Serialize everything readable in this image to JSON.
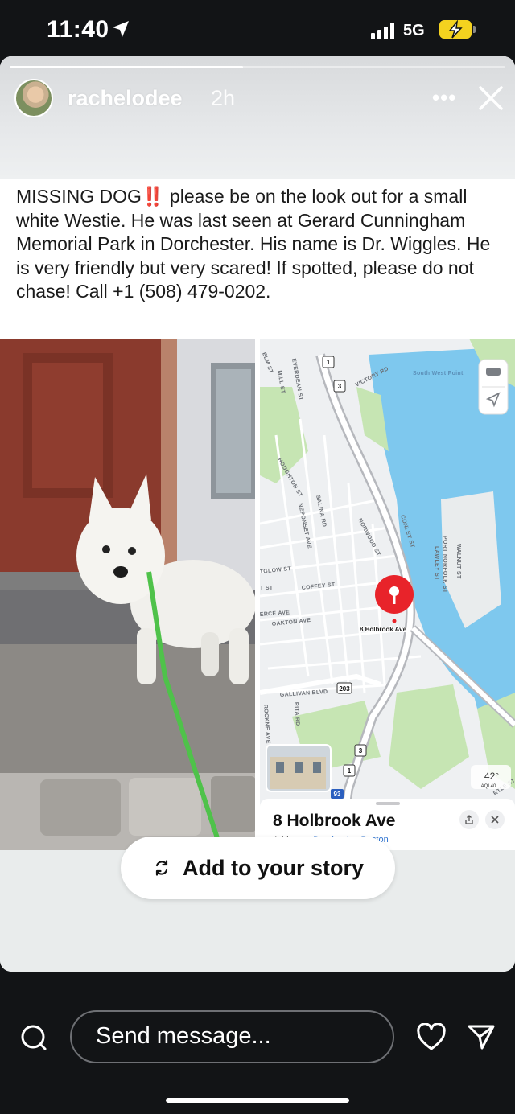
{
  "status_bar": {
    "time": "11:40",
    "network": "5G"
  },
  "story": {
    "username": "rachelodee",
    "posted_ago": "2h",
    "progress": 0.47,
    "post_text": "MISSING DOG‼️ please be on the look out for a small white Westie. He was last seen at Gerard Cunningham Memorial Park in Dorchester. His name is Dr. Wiggles. He is very friendly but very scared! If spotted, please do not chase! Call +1 (508) 479-0202."
  },
  "map": {
    "pin_label": "8 Holbrook Ave",
    "place_title": "8 Holbrook Ave",
    "place_type": "Address",
    "place_separator": " · ",
    "place_location": "Dorchester, Boston",
    "temperature": "42°",
    "aqi": "AQI 40",
    "area_label": "South West Point",
    "streets": {
      "victory_rd": "VICTORY RD",
      "everdean": "EVERDEAN ST",
      "mill": "MILL ST",
      "houghton": "HOUGHTON ST",
      "neponset": "NEPONSET AVE",
      "salina": "SALINA RD",
      "norwood": "NORWOOD ST",
      "conley": "CONLEY ST",
      "walnut": "WALNUT ST",
      "port_norfolk": "PORT NORFOLK ST",
      "lawley": "LAWLEY ST",
      "coffey": "COFFEY ST",
      "oakton": "OAKTON AVE",
      "gallivan": "GALLIVAN BLVD",
      "rita": "RITA RD",
      "rockne": "ROCKNE AVE",
      "elm": "ELM ST",
      "fragment_glow": "TGLOW ST",
      "fragment_t": "T ST",
      "fragment_erce": "ERCE AVE",
      "fragment_rtle": "RTLE ST"
    },
    "route_shields": {
      "r1_top": "1",
      "r3_top": "3",
      "r203": "203",
      "r3_bottom": "3",
      "r1_bottom": "1",
      "i93": "93"
    }
  },
  "actions": {
    "add_to_story": "Add to your story",
    "send_message_placeholder": "Send message..."
  },
  "colors": {
    "pin": "#e8232a",
    "water": "#7ec8ee",
    "park": "#c6e5b3",
    "map_route": "#5a8fd6"
  }
}
